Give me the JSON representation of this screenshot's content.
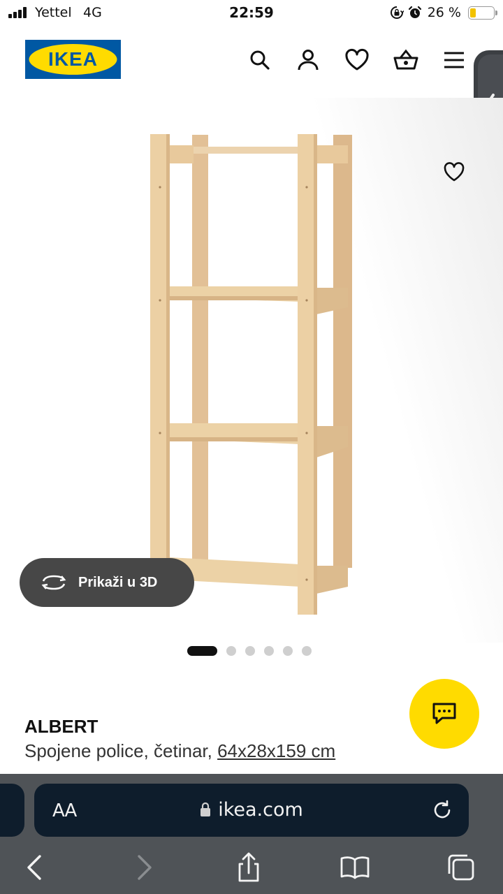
{
  "status_bar": {
    "carrier": "Yettel",
    "network": "4G",
    "time": "22:59",
    "battery_percent": "26 %",
    "battery_level": 0.26,
    "icons": [
      "signal-icon",
      "rotation-lock-icon",
      "alarm-icon",
      "battery-icon"
    ]
  },
  "header": {
    "logo_text": "IKEA",
    "icons": [
      "search-icon",
      "account-icon",
      "wishlist-icon",
      "basket-icon",
      "menu-icon"
    ]
  },
  "gallery": {
    "show_3d_label": "Prikaži u 3D",
    "slide_count": 6,
    "active_slide": 1
  },
  "product": {
    "name": "ALBERT",
    "description": "Spojene police, četinar, ",
    "dimensions": "64x28x159 cm"
  },
  "browser": {
    "text_size_label": "AA",
    "url": "ikea.com",
    "toolbar_icons": [
      "back-icon",
      "forward-icon",
      "share-icon",
      "bookmarks-icon",
      "tabs-icon"
    ]
  },
  "colors": {
    "ikea_blue": "#0058a3",
    "ikea_yellow": "#ffdb00",
    "browser_bar": "#0e1d2c",
    "toolbar_bg": "#4f5357"
  }
}
